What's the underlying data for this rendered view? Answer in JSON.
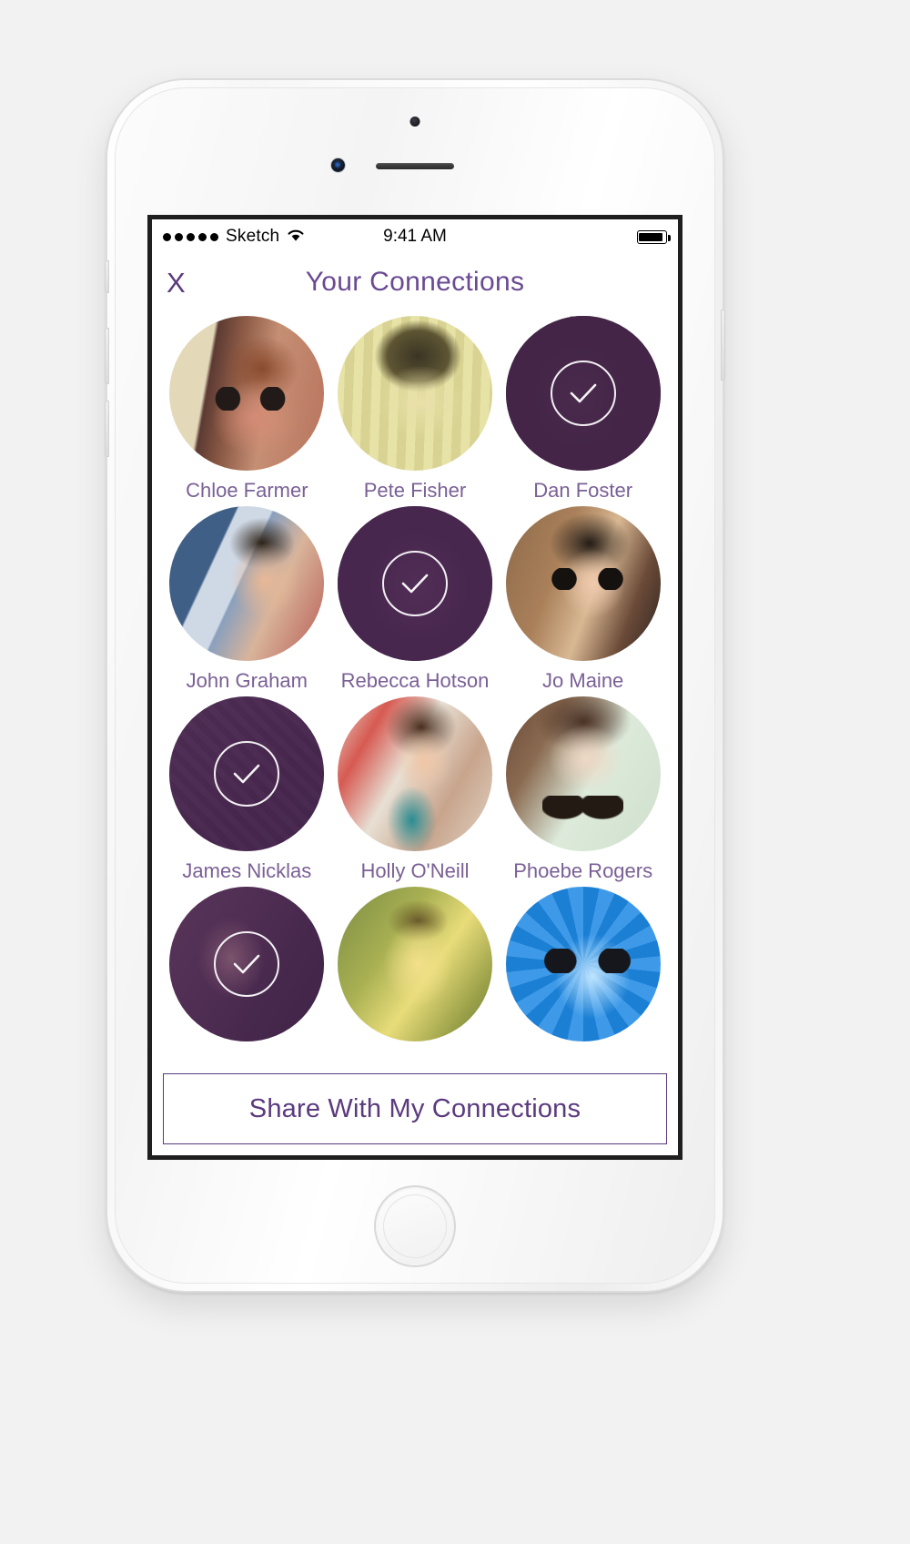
{
  "device": {
    "type": "iphone-mockup",
    "color": "silver-white"
  },
  "status_bar": {
    "signal_dots": 5,
    "carrier": "Sketch",
    "wifi_icon": "wifi-icon",
    "time": "9:41 AM",
    "battery_icon": "battery-full-icon"
  },
  "nav_bar": {
    "close_label": "X",
    "title": "Your Connections"
  },
  "colors": {
    "title_purple": "#6a4a92",
    "name_purple": "#7a6096",
    "accent_purple": "#5b3a7e",
    "selected_overlay": "rgba(74,38,82,0.62)"
  },
  "connections": [
    {
      "name": "Chloe Farmer",
      "selected": false,
      "avatar_class": "av-chloe"
    },
    {
      "name": "Pete Fisher",
      "selected": false,
      "avatar_class": "av-pete"
    },
    {
      "name": "Dan Foster",
      "selected": true,
      "avatar_class": "av-dan"
    },
    {
      "name": "John Graham",
      "selected": false,
      "avatar_class": "av-john"
    },
    {
      "name": "Rebecca Hotson",
      "selected": true,
      "avatar_class": "av-rebecca"
    },
    {
      "name": "Jo Maine",
      "selected": false,
      "avatar_class": "av-jo"
    },
    {
      "name": "James Nicklas",
      "selected": true,
      "avatar_class": "av-james"
    },
    {
      "name": "Holly O'Neill",
      "selected": false,
      "avatar_class": "av-holly"
    },
    {
      "name": "Phoebe Rogers",
      "selected": false,
      "avatar_class": "av-phoebe"
    },
    {
      "name": "",
      "selected": true,
      "avatar_class": "av-person10"
    },
    {
      "name": "",
      "selected": false,
      "avatar_class": "av-person11"
    },
    {
      "name": "",
      "selected": false,
      "avatar_class": "av-person12"
    }
  ],
  "share_button": {
    "label": "Share With My Connections"
  }
}
